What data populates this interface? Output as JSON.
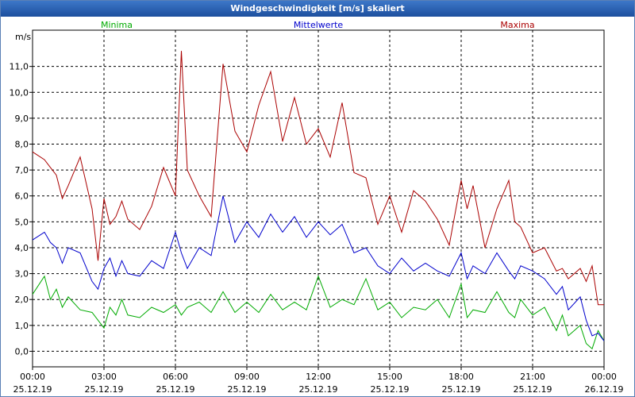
{
  "window": {
    "title": "Windgeschwindigkeit [m/s] skaliert"
  },
  "chart_data": {
    "type": "line",
    "title": "Windgeschwindigkeit [m/s] skaliert",
    "ylabel": "m/s",
    "ylim": [
      -0.6,
      12.4
    ],
    "yticks": [
      0.0,
      1.0,
      2.0,
      3.0,
      4.0,
      5.0,
      6.0,
      7.0,
      8.0,
      9.0,
      10.0,
      11.0
    ],
    "ytick_labels": [
      "0,0",
      "1,0",
      "2,0",
      "3,0",
      "4,0",
      "5,0",
      "6,0",
      "7,0",
      "8,0",
      "9,0",
      "10,0",
      "11,0"
    ],
    "xlim_hours": [
      0,
      24
    ],
    "xticks": [
      {
        "hour": 0,
        "time": "00:00",
        "date": "25.12.19"
      },
      {
        "hour": 3,
        "time": "03:00",
        "date": "25.12.19"
      },
      {
        "hour": 6,
        "time": "06:00",
        "date": "25.12.19"
      },
      {
        "hour": 9,
        "time": "09:00",
        "date": "25.12.19"
      },
      {
        "hour": 12,
        "time": "12:00",
        "date": "25.12.19"
      },
      {
        "hour": 15,
        "time": "15:00",
        "date": "25.12.19"
      },
      {
        "hour": 18,
        "time": "18:00",
        "date": "25.12.19"
      },
      {
        "hour": 21,
        "time": "21:00",
        "date": "25.12.19"
      },
      {
        "hour": 24,
        "time": "00:00",
        "date": "26.12.19"
      }
    ],
    "grid": true,
    "legend_position": "top",
    "series": [
      {
        "name": "Minima",
        "color": "#00aa00",
        "x": [
          0,
          0.5,
          0.75,
          1,
          1.25,
          1.5,
          2,
          2.5,
          2.75,
          3,
          3.25,
          3.5,
          3.75,
          4,
          4.5,
          5,
          5.5,
          6,
          6.25,
          6.5,
          7,
          7.5,
          8,
          8.5,
          9,
          9.5,
          10,
          10.5,
          11,
          11.5,
          12,
          12.5,
          13,
          13.5,
          14,
          14.5,
          15,
          15.5,
          16,
          16.5,
          17,
          17.5,
          18,
          18.25,
          18.5,
          19,
          19.5,
          20,
          20.25,
          20.5,
          21,
          21.5,
          22,
          22.25,
          22.5,
          23,
          23.25,
          23.5,
          23.75,
          24
        ],
        "values": [
          2.2,
          2.9,
          2.0,
          2.4,
          1.7,
          2.1,
          1.6,
          1.5,
          1.2,
          0.9,
          1.7,
          1.4,
          2.0,
          1.4,
          1.3,
          1.7,
          1.5,
          1.8,
          1.4,
          1.7,
          1.9,
          1.5,
          2.3,
          1.5,
          1.9,
          1.5,
          2.2,
          1.6,
          1.9,
          1.6,
          2.9,
          1.7,
          2.0,
          1.8,
          2.8,
          1.6,
          1.9,
          1.3,
          1.7,
          1.6,
          2.0,
          1.3,
          2.6,
          1.3,
          1.6,
          1.5,
          2.3,
          1.5,
          1.3,
          2.0,
          1.4,
          1.7,
          0.8,
          1.4,
          0.6,
          1.0,
          0.3,
          0.1,
          0.8,
          0.4
        ]
      },
      {
        "name": "Mittelwerte",
        "color": "#0000cc",
        "x": [
          0,
          0.5,
          0.75,
          1,
          1.25,
          1.5,
          2,
          2.5,
          2.75,
          3,
          3.25,
          3.5,
          3.75,
          4,
          4.5,
          5,
          5.5,
          6,
          6.25,
          6.5,
          7,
          7.5,
          8,
          8.5,
          9,
          9.5,
          10,
          10.5,
          11,
          11.5,
          12,
          12.5,
          13,
          13.5,
          14,
          14.5,
          15,
          15.5,
          16,
          16.5,
          17,
          17.5,
          18,
          18.25,
          18.5,
          19,
          19.5,
          20,
          20.25,
          20.5,
          21,
          21.5,
          22,
          22.25,
          22.5,
          23,
          23.25,
          23.5,
          23.75,
          24
        ],
        "values": [
          4.3,
          4.6,
          4.2,
          4.0,
          3.4,
          4.0,
          3.8,
          2.7,
          2.4,
          3.2,
          3.6,
          2.9,
          3.5,
          3.0,
          2.9,
          3.5,
          3.2,
          4.6,
          3.8,
          3.2,
          4.0,
          3.7,
          6.0,
          4.2,
          5.0,
          4.4,
          5.3,
          4.6,
          5.2,
          4.4,
          5.0,
          4.5,
          4.9,
          3.8,
          4.0,
          3.3,
          3.0,
          3.6,
          3.1,
          3.4,
          3.1,
          2.9,
          3.8,
          2.8,
          3.3,
          3.0,
          3.8,
          3.1,
          2.8,
          3.3,
          3.1,
          2.8,
          2.2,
          2.5,
          1.6,
          2.1,
          1.2,
          0.6,
          0.7,
          0.4
        ]
      },
      {
        "name": "Maxima",
        "color": "#aa0000",
        "x": [
          0,
          0.5,
          0.75,
          1,
          1.25,
          1.5,
          2,
          2.5,
          2.75,
          3,
          3.25,
          3.5,
          3.75,
          4,
          4.5,
          5,
          5.5,
          6,
          6.25,
          6.5,
          7,
          7.5,
          8,
          8.5,
          9,
          9.5,
          10,
          10.5,
          11,
          11.5,
          12,
          12.5,
          13,
          13.5,
          14,
          14.5,
          15,
          15.5,
          16,
          16.5,
          17,
          17.5,
          18,
          18.25,
          18.5,
          19,
          19.5,
          20,
          20.25,
          20.5,
          21,
          21.5,
          22,
          22.25,
          22.5,
          23,
          23.25,
          23.5,
          23.75,
          24
        ],
        "values": [
          7.7,
          7.4,
          7.1,
          6.8,
          5.9,
          6.4,
          7.5,
          5.5,
          3.5,
          5.9,
          4.9,
          5.2,
          5.8,
          5.1,
          4.7,
          5.6,
          7.1,
          6.0,
          11.6,
          7.0,
          6.0,
          5.2,
          11.1,
          8.5,
          7.7,
          9.5,
          10.8,
          8.1,
          9.8,
          8.0,
          8.6,
          7.5,
          9.6,
          6.9,
          6.7,
          4.9,
          6.0,
          4.6,
          6.2,
          5.8,
          5.1,
          4.1,
          6.6,
          5.5,
          6.4,
          4.0,
          5.5,
          6.6,
          5.0,
          4.8,
          3.8,
          4.0,
          3.1,
          3.2,
          2.8,
          3.2,
          2.7,
          3.3,
          1.8,
          1.8
        ]
      }
    ]
  }
}
